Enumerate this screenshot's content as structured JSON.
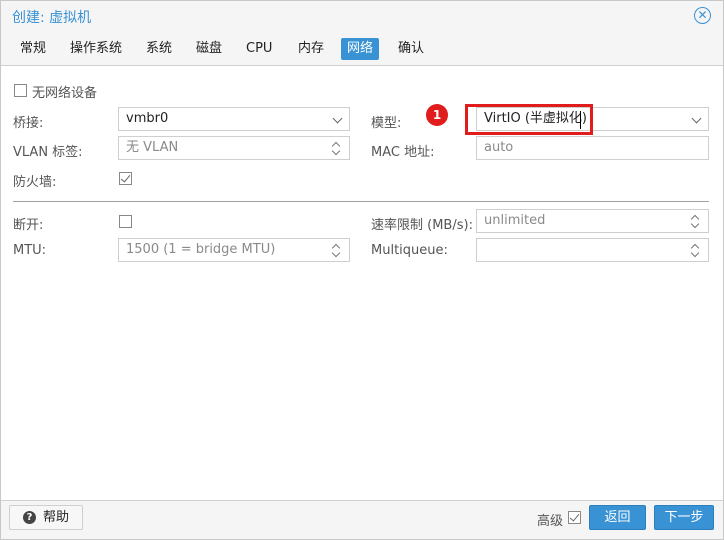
{
  "window": {
    "title": "创建: 虚拟机",
    "close_icon": "close-circle-icon"
  },
  "tabs": [
    {
      "label": "常规"
    },
    {
      "label": "操作系统"
    },
    {
      "label": "系统"
    },
    {
      "label": "磁盘"
    },
    {
      "label": "CPU"
    },
    {
      "label": "内存"
    },
    {
      "label": "网络",
      "active": true
    },
    {
      "label": "确认"
    }
  ],
  "form": {
    "no_network": {
      "label": "无网络设备",
      "checked": false
    },
    "bridge": {
      "label": "桥接:",
      "value": "vmbr0"
    },
    "vlan": {
      "label": "VLAN 标签:",
      "value": "无 VLAN"
    },
    "firewall": {
      "label": "防火墙:",
      "checked": true
    },
    "model": {
      "label": "模型:",
      "value": "VirtIO (半虚拟化)"
    },
    "mac": {
      "label": "MAC 地址:",
      "value": "auto"
    },
    "disconnect": {
      "label": "断开:",
      "checked": false
    },
    "mtu": {
      "label": "MTU:",
      "value": "1500 (1 = bridge MTU)"
    },
    "rate": {
      "label": "速率限制 (MB/s):",
      "value": "unlimited"
    },
    "multiqueue": {
      "label": "Multiqueue:",
      "value": ""
    }
  },
  "annotation": {
    "marker": "1",
    "color": "#e01c1c"
  },
  "footer": {
    "help_label": "帮助",
    "advanced_label": "高级",
    "advanced_checked": true,
    "back_label": "返回",
    "next_label": "下一步"
  },
  "colors": {
    "accent": "#3892d4"
  }
}
